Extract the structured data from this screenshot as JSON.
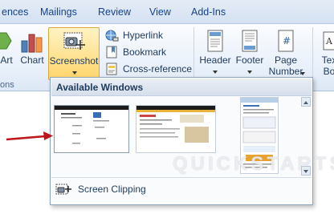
{
  "tabs": [
    "ences",
    "Mailings",
    "Review",
    "View",
    "Add-Ins"
  ],
  "ribbon": {
    "smartart_label": "Art",
    "chart_label": "Chart",
    "screenshot_label": "Screenshot",
    "hyperlink_label": "Hyperlink",
    "bookmark_label": "Bookmark",
    "crossref_label": "Cross-reference",
    "header_label": "Header",
    "footer_label": "Footer",
    "pagenumber_label": "Page Number",
    "textbox_label": "Tex Bo",
    "group_fragment_label": "ons"
  },
  "menu": {
    "heading": "Available Windows",
    "clipping_label": "Screen Clipping"
  },
  "watermark": "QUICKSTARTS",
  "colors": {
    "highlight": "#ffd56b",
    "arrow": "#c0141b"
  }
}
